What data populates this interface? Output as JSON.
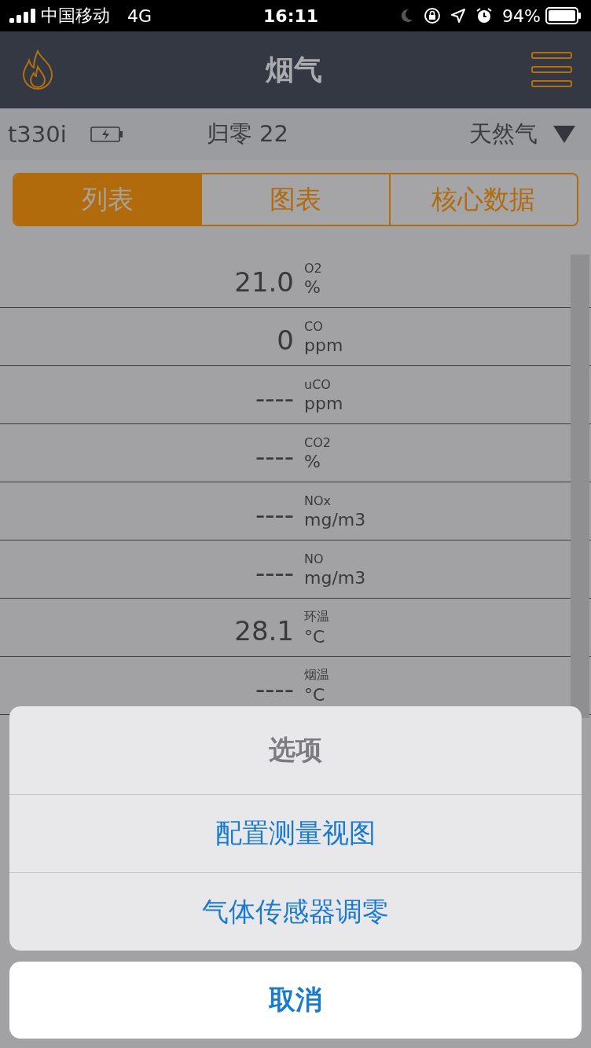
{
  "status_bar": {
    "carrier": "中国移动",
    "network": "4G",
    "time": "16:11",
    "battery": "94%"
  },
  "nav_bar": {
    "title": "烟气"
  },
  "info_bar": {
    "device": "t330i",
    "zero": "归零 22",
    "fuel": "天然气"
  },
  "tabs": [
    {
      "label": "列表",
      "selected": true
    },
    {
      "label": "图表",
      "selected": false
    },
    {
      "label": "核心数据",
      "selected": false
    }
  ],
  "readings": [
    {
      "value": "21.0",
      "name": "O2",
      "unit": "%"
    },
    {
      "value": "0",
      "name": "CO",
      "unit": "ppm"
    },
    {
      "value": "----",
      "name": "uCO",
      "unit": "ppm"
    },
    {
      "value": "----",
      "name": "CO2",
      "unit": "%"
    },
    {
      "value": "----",
      "name": "NOx",
      "unit": "mg/m3"
    },
    {
      "value": "----",
      "name": "NO",
      "unit": "mg/m3"
    },
    {
      "value": "28.1",
      "name": "环温",
      "unit": "°C"
    },
    {
      "value": "----",
      "name": "烟温",
      "unit": "°C"
    }
  ],
  "action_sheet": {
    "title": "选项",
    "options": [
      "配置测量视图",
      "气体传感器调零"
    ],
    "cancel": "取消"
  }
}
